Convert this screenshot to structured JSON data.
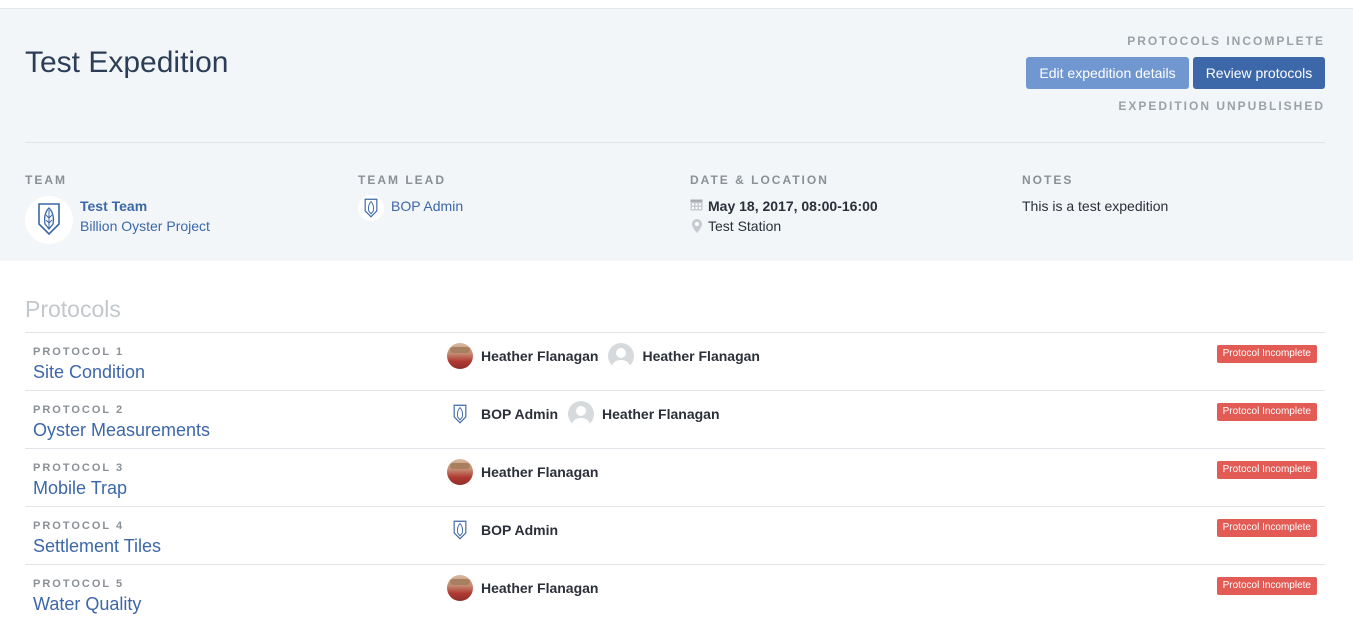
{
  "expedition": {
    "title": "Test Expedition",
    "protocols_status": "PROTOCOLS INCOMPLETE",
    "publish_status": "EXPEDITION UNPUBLISHED",
    "edit_button": "Edit expedition details",
    "review_button": "Review protocols"
  },
  "meta": {
    "team_label": "TEAM",
    "team_name": "Test Team",
    "team_org": "Billion Oyster Project",
    "lead_label": "TEAM LEAD",
    "lead_name": "BOP Admin",
    "date_label": "DATE & LOCATION",
    "date": "May 18, 2017, 08:00-16:00",
    "location": "Test Station",
    "notes_label": "NOTES",
    "notes": "This is a test expedition"
  },
  "protocols": {
    "title": "Protocols",
    "rows": [
      {
        "number": "PROTOCOL 1",
        "name": "Site Condition",
        "users": [
          {
            "name": "Heather Flanagan",
            "avatar": "photo"
          },
          {
            "name": "Heather Flanagan",
            "avatar": "blank"
          }
        ],
        "status": "Protocol Incomplete"
      },
      {
        "number": "PROTOCOL 2",
        "name": "Oyster Measurements",
        "users": [
          {
            "name": "BOP Admin",
            "avatar": "logo"
          },
          {
            "name": "Heather Flanagan",
            "avatar": "blank"
          }
        ],
        "status": "Protocol Incomplete"
      },
      {
        "number": "PROTOCOL 3",
        "name": "Mobile Trap",
        "users": [
          {
            "name": "Heather Flanagan",
            "avatar": "photo"
          }
        ],
        "status": "Protocol Incomplete"
      },
      {
        "number": "PROTOCOL 4",
        "name": "Settlement Tiles",
        "users": [
          {
            "name": "BOP Admin",
            "avatar": "logo"
          }
        ],
        "status": "Protocol Incomplete"
      },
      {
        "number": "PROTOCOL 5",
        "name": "Water Quality",
        "users": [
          {
            "name": "Heather Flanagan",
            "avatar": "photo"
          }
        ],
        "status": "Protocol Incomplete"
      }
    ]
  },
  "colors": {
    "accent": "#3c67a8",
    "accent_light": "#7197d1",
    "badge": "#e25b55",
    "header_bg": "#f3f6f8"
  }
}
